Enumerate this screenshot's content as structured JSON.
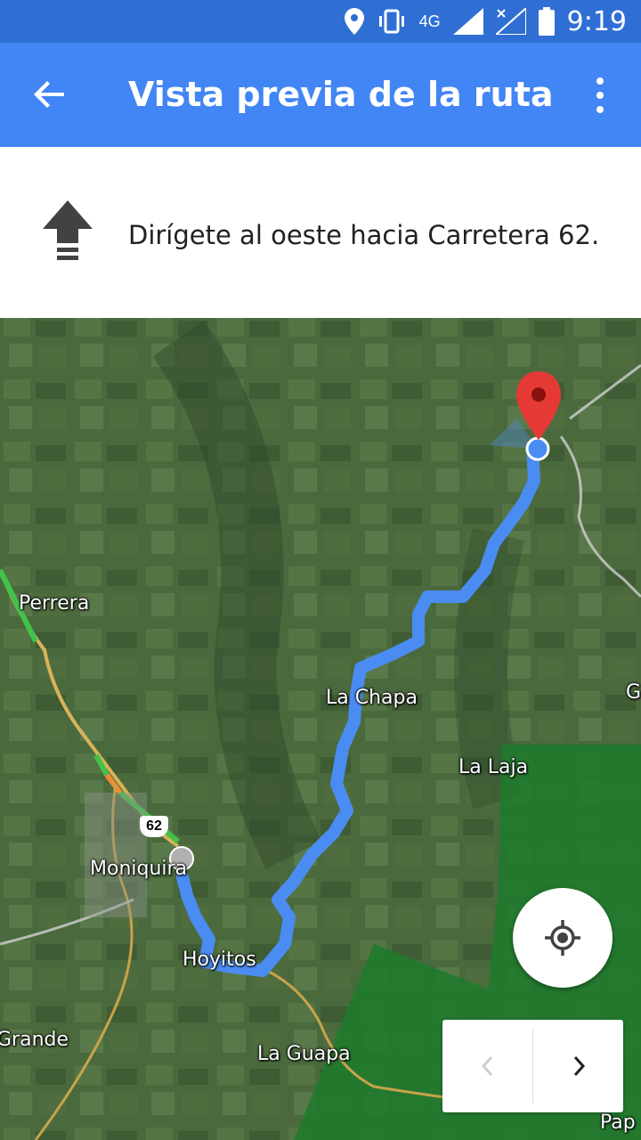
{
  "status_bar": {
    "network_label": "4G",
    "time": "9:19",
    "icons": [
      "location-icon",
      "vibrate-icon",
      "network-4g-icon",
      "signal-icon",
      "no-signal-icon",
      "battery-icon"
    ]
  },
  "app_bar": {
    "title": "Vista previa de la ruta",
    "back_icon": "arrow-back-icon",
    "menu_icon": "more-vert-icon",
    "color": "#4285f4"
  },
  "instruction": {
    "text": "Dirígete al oeste hacia Carretera 62.",
    "icon": "straight-arrow-icon"
  },
  "map": {
    "route_color": "#4a8cf2",
    "destination_pin_color": "#e53935",
    "places": {
      "perrera": "Perrera",
      "la_chapa": "La Chapa",
      "la_laja": "La Laja",
      "moniquira": "Moniquira",
      "hoyitos": "Hoyitos",
      "grande": "Grande",
      "la_guapa": "La Guapa",
      "g": "G",
      "pap": "Pap"
    },
    "road_shield": "62"
  },
  "controls": {
    "my_location_icon": "my-location-icon",
    "prev_icon": "chevron-left-icon",
    "next_icon": "chevron-right-icon"
  }
}
